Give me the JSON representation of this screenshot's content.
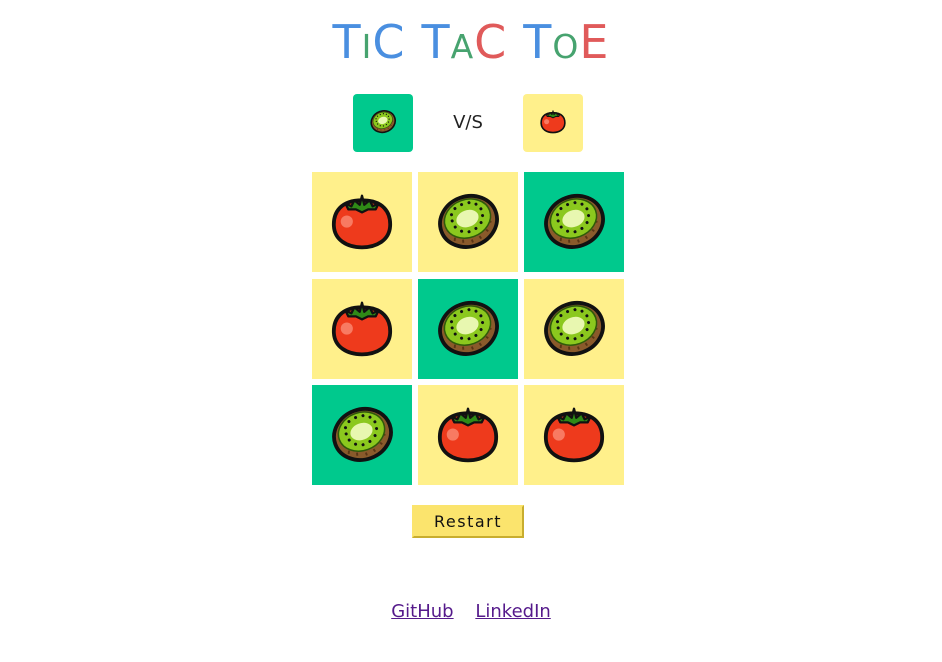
{
  "title": {
    "letters": [
      {
        "ch": "T",
        "size": "big",
        "color": "#4a8fe0"
      },
      {
        "ch": "I",
        "size": "small",
        "color": "#47a36f"
      },
      {
        "ch": "C",
        "size": "big",
        "color": "#4a8fe0"
      },
      {
        "ch": " ",
        "size": "gap",
        "color": ""
      },
      {
        "ch": "T",
        "size": "big",
        "color": "#4a8fe0"
      },
      {
        "ch": "A",
        "size": "small",
        "color": "#47a36f"
      },
      {
        "ch": "C",
        "size": "big",
        "color": "#e05a5a"
      },
      {
        "ch": " ",
        "size": "gap",
        "color": ""
      },
      {
        "ch": "T",
        "size": "big",
        "color": "#4a8fe0"
      },
      {
        "ch": "O",
        "size": "small",
        "color": "#47a36f"
      },
      {
        "ch": "E",
        "size": "big",
        "color": "#e05a5a"
      }
    ]
  },
  "players": {
    "left": {
      "icon": "kiwi-icon",
      "bg": "#00c98d"
    },
    "vs_label": "V/S",
    "right": {
      "icon": "tomato-icon",
      "bg": "#fff08b"
    }
  },
  "board": {
    "cells": [
      {
        "fruit": "tomato",
        "bg": "#fff08b"
      },
      {
        "fruit": "kiwi",
        "bg": "#fff08b"
      },
      {
        "fruit": "kiwi",
        "bg": "#00c98d"
      },
      {
        "fruit": "tomato",
        "bg": "#fff08b"
      },
      {
        "fruit": "kiwi",
        "bg": "#00c98d"
      },
      {
        "fruit": "kiwi",
        "bg": "#fff08b"
      },
      {
        "fruit": "kiwi",
        "bg": "#00c98d"
      },
      {
        "fruit": "tomato",
        "bg": "#fff08b"
      },
      {
        "fruit": "tomato",
        "bg": "#fff08b"
      }
    ]
  },
  "restart_label": "Restart",
  "links": {
    "github": "GitHub",
    "linkedin": "LinkedIn"
  },
  "colors": {
    "yellow": "#fff08b",
    "green": "#00c98d",
    "button": "#fbe46d",
    "link": "#551a8b"
  }
}
